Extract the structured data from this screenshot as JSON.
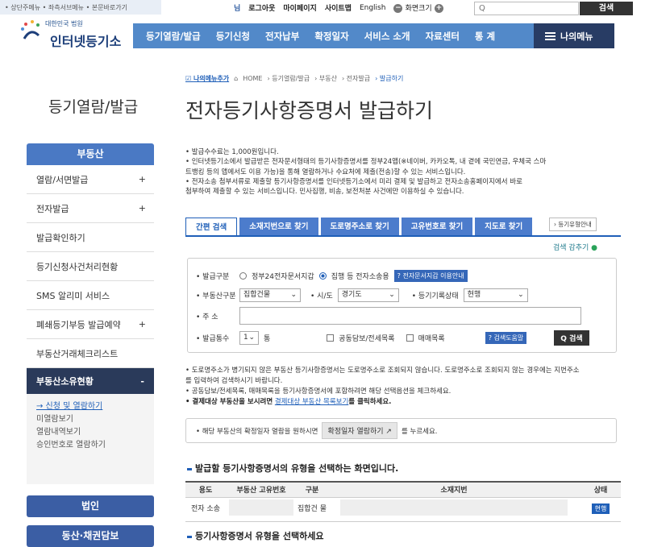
{
  "skip_links": "• 상단주메뉴 • 좌측서브메뉴 • 본문바로가기",
  "util": {
    "user_suffix": "님",
    "logout": "로그아웃",
    "mypage": "마이페이지",
    "sitemap": "사이트맵",
    "english": "English",
    "zoom_label": "화면크기",
    "zoom_minus": "−",
    "zoom_plus": "+",
    "search_placeholder": "Q",
    "search_button": "검색"
  },
  "logo": {
    "sub": "대한민국 법원",
    "main": "인터넷등기소"
  },
  "gnb": [
    "등기열람/발급",
    "등기신청",
    "전자납부",
    "확정일자",
    "서비스 소개",
    "자료센터",
    "통 계"
  ],
  "my_menu": "나의메뉴",
  "breadcrumb": {
    "add": "나의메뉴추가",
    "items": [
      "HOME",
      "› 등기열람/발급",
      "› 부동산",
      "› 전자발급",
      "› 발급하기"
    ]
  },
  "side": {
    "title": "등기열람/발급",
    "head": "부동산",
    "items": [
      {
        "label": "열람/서면발급",
        "plus": "+"
      },
      {
        "label": "전자발급",
        "plus": "+"
      },
      {
        "label": "발급확인하기",
        "plus": ""
      },
      {
        "label": "등기신청사건처리현황",
        "plus": ""
      },
      {
        "label": "SMS 알리미 서비스",
        "plus": ""
      },
      {
        "label": "폐쇄등기부등 발급예약",
        "plus": "+"
      },
      {
        "label": "부동산거래체크리스트",
        "plus": ""
      }
    ],
    "active": {
      "label": "부동산소유현황",
      "minus": "-"
    },
    "sub": [
      "→ 신청 및 열람하기",
      "미열람보기",
      "열람내역보기",
      "승인번호로 열람하기"
    ],
    "buttons": [
      "법인",
      "동산·채권담보"
    ]
  },
  "page_title": "전자등기사항증명서 발급하기",
  "notes": [
    "• 발급수수료는 1,000원입니다.",
    "• 인터넷등기소에서 발급받은 전자문서형태의 등기사항증명서를 정부24앱(※네이버, 카카오톡, 내 곁에 국민연금, 우체국 스마",
    "  트뱅킹 등의 앱에서도 이용 가능)을 통해 열람하거나 수요처에 제출(전송)할 수 있는 서비스입니다.",
    "• 전자소송 첨부서류로 제출할 등기사항증명서를 인터넷등기소에서 미리 결제 및 발급하고 전자소송홈페이지에서 바로",
    "  첨부하여 제출할 수 있는 서비스입니다. 민사집행, 비송, 보전처분 사건에만 이용하실 수 있습니다."
  ],
  "tabs": [
    "간편 검색",
    "소재지번으로 찾기",
    "도로명주소로 찾기",
    "고유번호로 찾기",
    "지도로 찾기"
  ],
  "reg_notice": "› 등기유형안내",
  "search_toggle": "검색 감추기",
  "form": {
    "issue_type_label": "• 발급구분",
    "radio1": "정부24전자문서지갑",
    "radio2": "집행 등 전자소송용",
    "radio_help": "? 전자문서지갑 이용안내",
    "prop_label": "• 부동산구분",
    "prop_value": "집합건물",
    "sido_label": "• 시/도",
    "sido_value": "경기도",
    "status_label": "• 등기기록상태",
    "status_value": "현행",
    "addr_label": "• 주 소",
    "count_label": "• 발급통수",
    "count_value": "1",
    "count_unit": "통",
    "check1": "공동담보/전세목록",
    "check2": "매매목록",
    "search_help": "? 검색도움말",
    "search_btn": "Q 검색"
  },
  "notes2": [
    "• 도로명주소가 병기되지 않은 부동산 등기사항증명서는 도로명주소로 조회되지 않습니다. 도로명주소로 조회되지 않는 경우에는 지번주소",
    "  를 입력하여 검색하시기 바랍니다.",
    "• 공동담보/전세목록, 매매목록을 등기사항증명서에 포함하려면 해당 선택옵션을 체크하세요."
  ],
  "notes2_bold": "• 결제대상 부동산을 보시려면",
  "notes2_link": "결제대상 부동산 목록보기",
  "notes2_tail": "를 클릭하세요.",
  "info": {
    "pre": "• 해당 부동산의 확정일자 열람을 원하시면",
    "btn": "확정일자 열람하기 ↗",
    "post": "를 누르세요."
  },
  "section_title": "발급할 등기사항증명서의 유형을 선택하는 화면입니다.",
  "table": {
    "headers": [
      "용도",
      "부동산 고유번호",
      "구분",
      "소재지번",
      "상태"
    ],
    "row": {
      "use": "전자 소송",
      "type": "집합건 물",
      "status": "현행"
    }
  },
  "section_title2": "등기사항증명서 유형을 선택하세요"
}
